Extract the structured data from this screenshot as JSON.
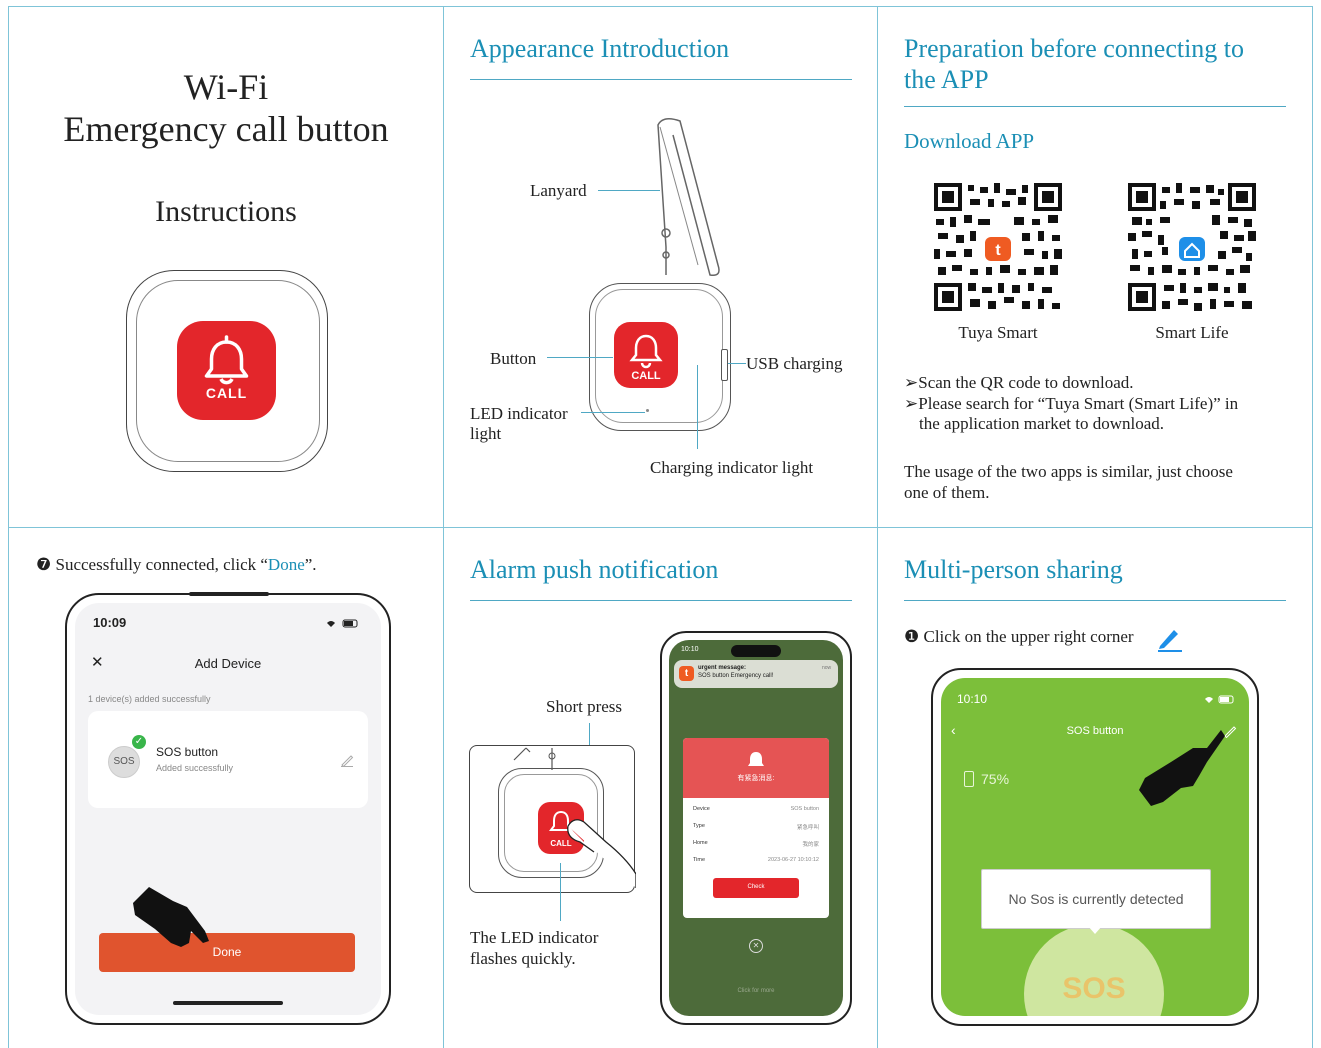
{
  "cover": {
    "title_line1": "Wi-Fi",
    "title_line2": "Emergency call button",
    "subtitle": "Instructions",
    "button_label": "CALL"
  },
  "appearance": {
    "heading": "Appearance Introduction",
    "labels": {
      "lanyard": "Lanyard",
      "button": "Button",
      "usb": "USB charging",
      "led_line1": "LED indicator",
      "led_line2": "light",
      "charging": "Charging indicator light"
    },
    "device_button_label": "CALL"
  },
  "preparation": {
    "heading_line1": "Preparation before connecting to",
    "heading_line2": "the APP",
    "download_heading": "Download APP",
    "apps": [
      "Tuya Smart",
      "Smart Life"
    ],
    "bullet1": "➢Scan the QR code to download.",
    "bullet2_line1": "➢Please search for “Tuya Smart (Smart Life)” in",
    "bullet2_line2": "the application market to download.",
    "note_line1": "The usage of the two apps is similar, just choose",
    "note_line2": "one of them."
  },
  "connected": {
    "step_marker": "❼",
    "step_text": "Successfully connected, click “",
    "step_link": "Done",
    "step_end": "”.",
    "phone": {
      "time": "10:09",
      "title": "Add Device",
      "close_glyph": "✕",
      "status": "1 device(s) added successfully",
      "device_badge": "SOS",
      "device_name": "SOS button",
      "device_status": "Added successfully",
      "done_label": "Done"
    }
  },
  "alarm": {
    "heading": "Alarm push notification",
    "short_press": "Short press",
    "led_line1": "The LED indicator",
    "led_line2": "flashes quickly.",
    "device_button_label": "CALL",
    "phone": {
      "time": "10:10",
      "notif_title": "urgent message:",
      "notif_body": "SOS button Emergency call!",
      "notif_time": "now",
      "card_title": "有紧急消息:",
      "rows": [
        {
          "label": "Device",
          "value": "SOS button"
        },
        {
          "label": "Type",
          "value": "紧急呼叫"
        },
        {
          "label": "Home",
          "value": "我的家"
        },
        {
          "label": "Time",
          "value": "2023-06-27 10:10:12"
        }
      ],
      "check_label": "Check",
      "bottom_hint": "Click for more"
    }
  },
  "sharing": {
    "heading": "Multi-person sharing",
    "step_marker": "❶",
    "step_text": "Click on the upper right corner",
    "phone": {
      "time": "10:10",
      "title": "SOS button",
      "battery": "75%",
      "status": "No Sos is currently detected",
      "sos_label": "SOS"
    }
  },
  "colors": {
    "teal": "#1b8fb5",
    "red": "#e3262b",
    "orange": "#e0542e",
    "green": "#7cbf3a"
  }
}
